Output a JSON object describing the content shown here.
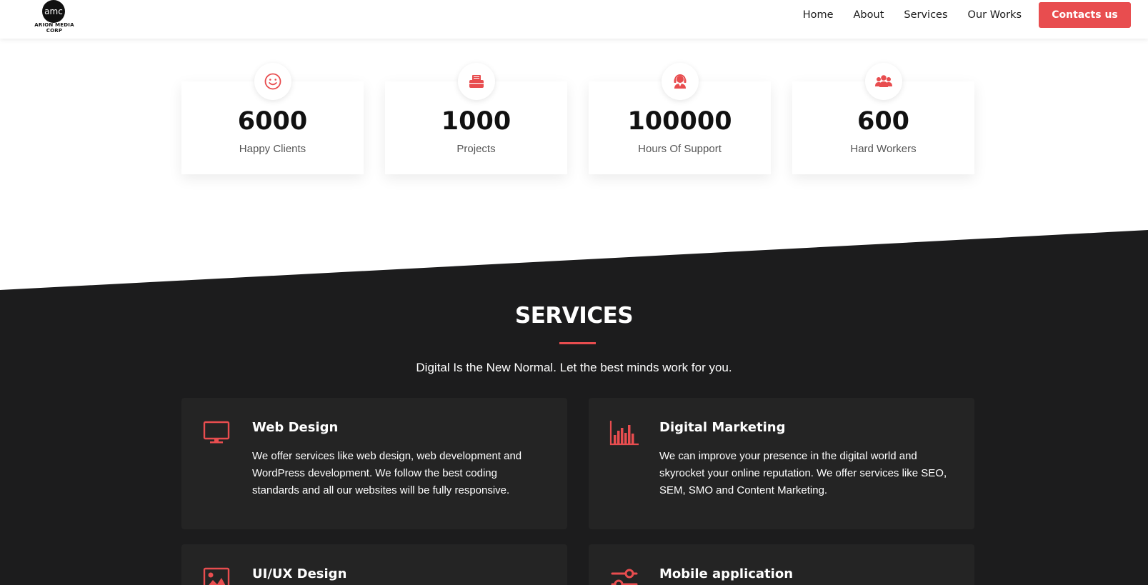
{
  "header": {
    "logo_text": "ARION MEDIA CORP",
    "logo_mark": "amc",
    "nav": [
      "Home",
      "About",
      "Services",
      "Our Works"
    ],
    "cta_label": "Contacts us"
  },
  "stats": [
    {
      "value": "6000",
      "label": "Happy Clients",
      "icon": "smiley-icon"
    },
    {
      "value": "1000",
      "label": "Projects",
      "icon": "briefcase-icon"
    },
    {
      "value": "100000",
      "label": "Hours Of Support",
      "icon": "headset-support-icon"
    },
    {
      "value": "600",
      "label": "Hard Workers",
      "icon": "users-icon"
    }
  ],
  "services": {
    "title": "SERVICES",
    "subtitle": "Digital Is the New Normal. Let the best minds work for you.",
    "items": [
      {
        "title": "Web Design",
        "icon": "monitor-icon",
        "desc": "We offer services like web design, web development and WordPress development. We follow the best coding standards and all our websites will be fully responsive."
      },
      {
        "title": "Digital Marketing",
        "icon": "bar-chart-icon",
        "desc": "We can improve your presence in the digital world and skyrocket your online reputation. We offer services like SEO, SEM, SMO and Content Marketing."
      },
      {
        "title": "UI/UX Design",
        "icon": "image-icon",
        "desc": ""
      },
      {
        "title": "Mobile application",
        "icon": "sliders-icon",
        "desc": ""
      }
    ]
  },
  "colors": {
    "accent": "#e84d4f",
    "dark_bg": "#1c1c1d",
    "card_bg": "#242424"
  }
}
